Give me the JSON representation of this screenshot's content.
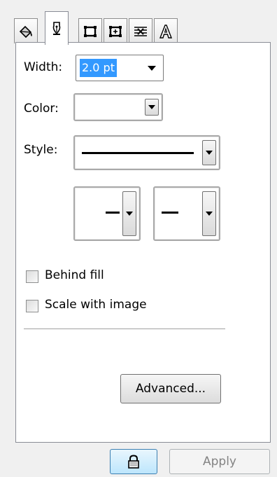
{
  "tabs": [
    {
      "icon": "fill-bucket-icon"
    },
    {
      "icon": "pen-nib-icon",
      "active": true
    },
    {
      "icon": "size-frame-icon"
    },
    {
      "icon": "position-frame-icon"
    },
    {
      "icon": "wrap-icon"
    },
    {
      "icon": "text-a-icon"
    }
  ],
  "fields": {
    "width_label": "Width:",
    "width_value": "2.0 pt",
    "color_label": "Color:",
    "style_label": "Style:"
  },
  "checkboxes": {
    "behind_fill": {
      "label": "Behind fill",
      "checked": false
    },
    "scale_with_image": {
      "label": "Scale with image",
      "checked": false
    }
  },
  "buttons": {
    "advanced": "Advanced...",
    "apply": "Apply",
    "lock_icon": "lock-icon"
  },
  "colors": {
    "selection": "#3399ff",
    "panel_border": "#898c95"
  }
}
